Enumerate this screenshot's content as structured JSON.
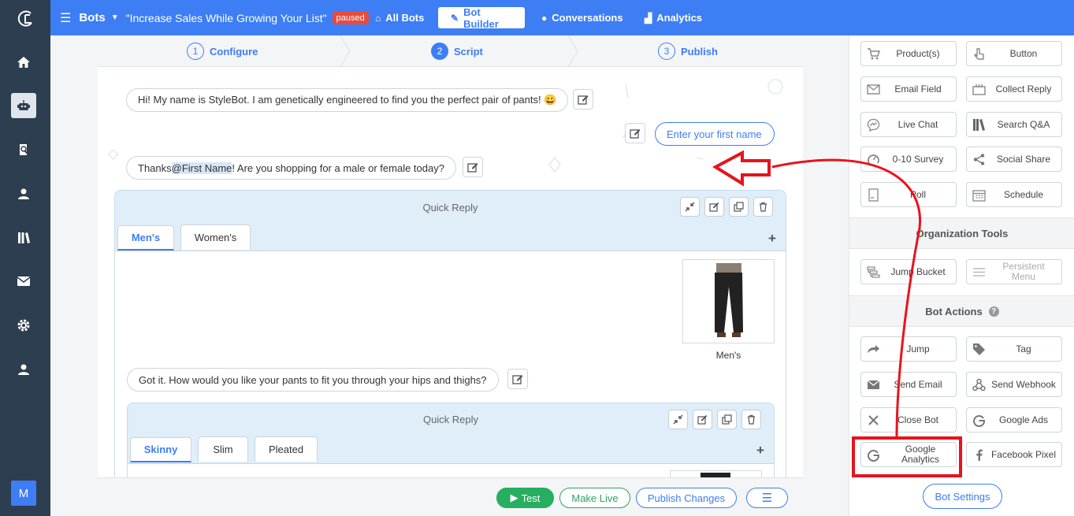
{
  "topbar": {
    "bots_label": "Bots",
    "bot_title": "\"Increase Sales While Growing Your List\"",
    "status_badge": "paused",
    "nav": [
      {
        "label": "All Bots",
        "icon": "home-icon"
      },
      {
        "label": "Bot Builder",
        "icon": "pencil-icon",
        "active": true
      },
      {
        "label": "Conversations",
        "icon": "chat-bubble-icon"
      },
      {
        "label": "Analytics",
        "icon": "bar-chart-icon"
      }
    ]
  },
  "rail": {
    "items": [
      "home-icon",
      "robot-icon",
      "book-icon",
      "user-icon",
      "library-icon",
      "mail-icon",
      "gear-icon",
      "account-icon"
    ],
    "account_initial": "M"
  },
  "steps": [
    {
      "num": "1",
      "label": "Configure"
    },
    {
      "num": "2",
      "label": "Script",
      "active": true
    },
    {
      "num": "3",
      "label": "Publish"
    }
  ],
  "script": {
    "msg1": "Hi! My name is StyleBot. I am genetically engineered to find you the perfect pair of pants! 😀",
    "user_reply": "Enter your first name",
    "msg2_before": "Thanks ",
    "msg2_mention": "@First Name",
    "msg2_after": "! Are you shopping for a male or female today?",
    "qr1": {
      "title": "Quick Reply",
      "tabs": [
        "Men's",
        "Women's"
      ],
      "product_label": "Men's"
    },
    "msg3": "Got it. How would you like your pants to fit you through your hips and thighs?",
    "qr2": {
      "title": "Quick Reply",
      "tabs": [
        "Skinny",
        "Slim",
        "Pleated"
      ]
    }
  },
  "bottom_bar": {
    "test": "Test",
    "make_live": "Make Live",
    "publish": "Publish Changes"
  },
  "right_panel": {
    "tools": [
      {
        "label": "Product(s)",
        "icon": "cart-icon"
      },
      {
        "label": "Button",
        "icon": "pointer-icon"
      },
      {
        "label": "Email Field",
        "icon": "envelope-icon"
      },
      {
        "label": "Collect Reply",
        "icon": "inbox-icon"
      },
      {
        "label": "Live Chat",
        "icon": "messenger-icon"
      },
      {
        "label": "Search Q&A",
        "icon": "books-icon"
      },
      {
        "label": "0-10 Survey",
        "icon": "gauge-icon"
      },
      {
        "label": "Social Share",
        "icon": "share-icon"
      },
      {
        "label": "Poll",
        "icon": "poll-icon"
      },
      {
        "label": "Schedule",
        "icon": "calendar-icon"
      }
    ],
    "org_tools_title": "Organization Tools",
    "org_tools": [
      {
        "label": "Jump Bucket",
        "icon": "bucket-icon"
      },
      {
        "label": "Persistent Menu",
        "icon": "menu-icon"
      }
    ],
    "bot_actions_title": "Bot Actions",
    "actions": [
      {
        "label": "Jump",
        "icon": "arrow-right-icon"
      },
      {
        "label": "Tag",
        "icon": "tag-icon"
      },
      {
        "label": "Send Email",
        "icon": "envelope-icon"
      },
      {
        "label": "Send Webhook",
        "icon": "webhook-icon"
      },
      {
        "label": "Close Bot",
        "icon": "close-icon"
      },
      {
        "label": "Google Ads",
        "icon": "google-icon"
      },
      {
        "label": "Google Analytics",
        "icon": "google-icon"
      },
      {
        "label": "Facebook Pixel",
        "icon": "facebook-icon"
      }
    ],
    "bot_settings": "Bot Settings"
  },
  "colors": {
    "brand": "#3d7ef5",
    "rail": "#2c3e50",
    "paused": "#e74c3c",
    "test": "#27ae60",
    "annotation": "#e8131c"
  }
}
